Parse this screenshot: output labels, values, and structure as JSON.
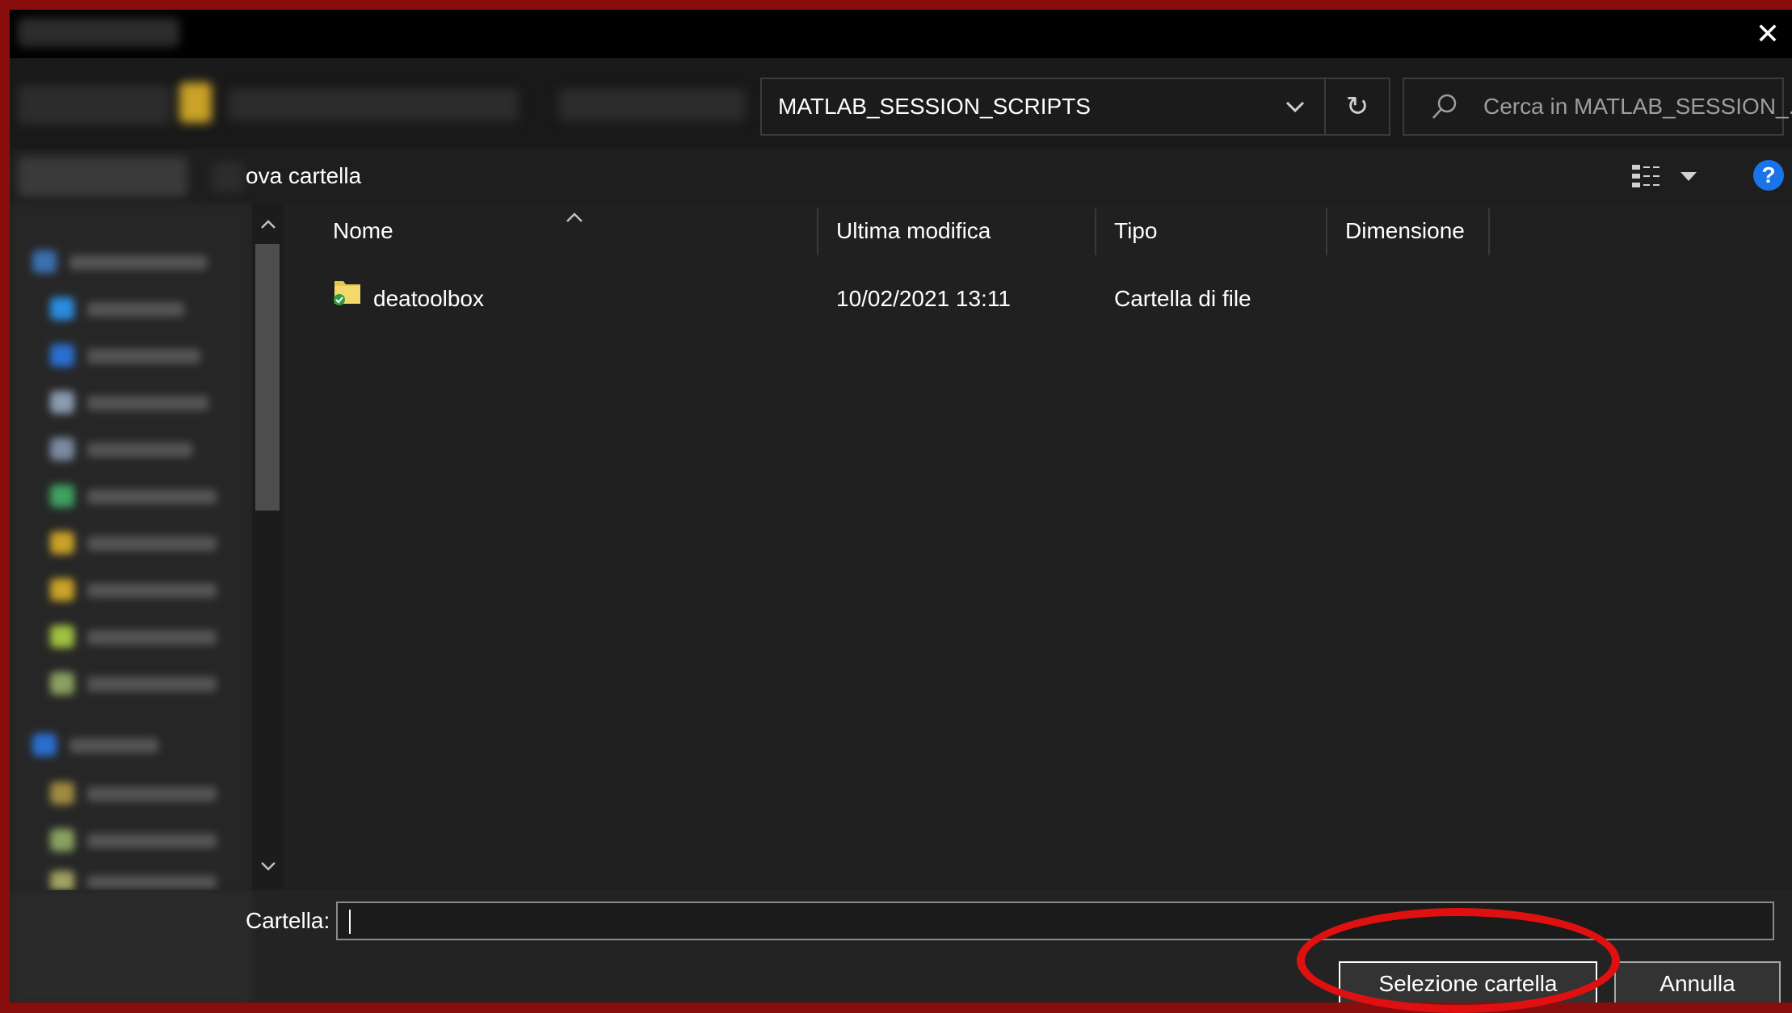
{
  "window": {
    "close_glyph": "✕"
  },
  "address_bar": {
    "path": "MATLAB_SESSION_SCRIPTS",
    "refresh_glyph": "↻"
  },
  "search": {
    "placeholder": "Cerca in MATLAB_SESSION_..."
  },
  "toolbar": {
    "new_folder_label": "ova cartella",
    "help_glyph": "?"
  },
  "file_list": {
    "columns": [
      "Nome",
      "Ultima modifica",
      "Tipo",
      "Dimensione"
    ],
    "rows": [
      {
        "name": "deatoolbox",
        "modified": "10/02/2021 13:11",
        "type": "Cartella di file",
        "size": ""
      }
    ]
  },
  "footer": {
    "folder_label": "Cartella:",
    "folder_value": "",
    "select_button": "Selezione cartella",
    "cancel_button": "Annulla"
  },
  "colors": {
    "highlight": "#e01010",
    "background": "#202020",
    "frame": "#8a0d0d",
    "help_blue": "#1a73e8"
  },
  "icons": {
    "close": "close-icon",
    "dropdown": "chevron-down-icon",
    "refresh": "refresh-icon",
    "search": "search-icon",
    "view": "details-view-icon",
    "help": "help-icon",
    "folder": "folder-icon"
  }
}
